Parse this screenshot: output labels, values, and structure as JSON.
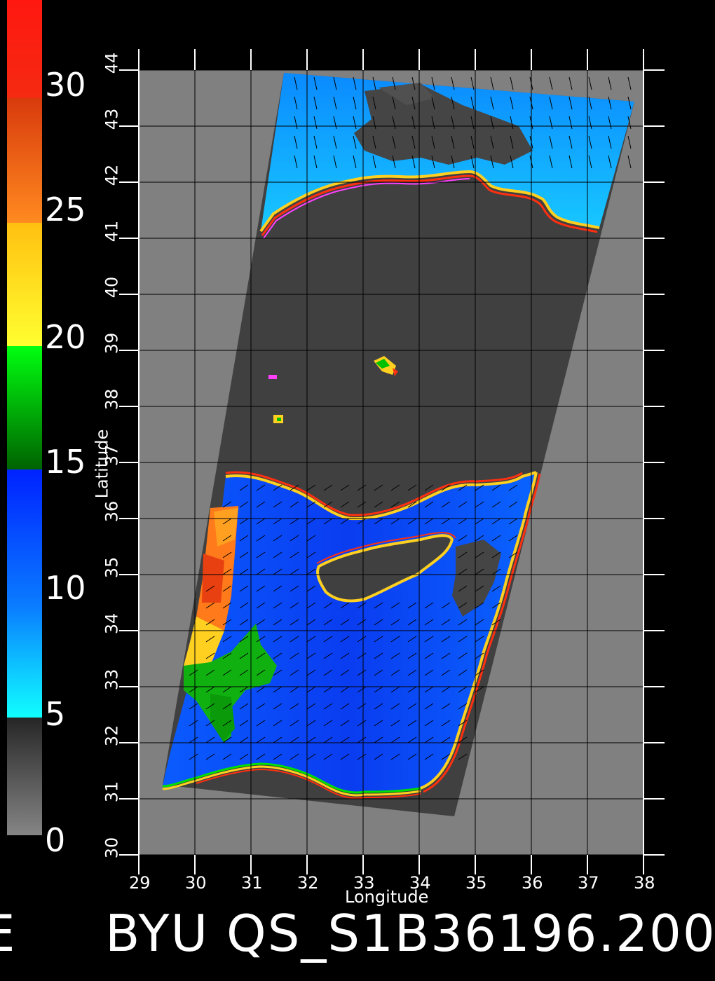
{
  "colorbar": {
    "labels": [
      "30",
      "25",
      "20",
      "15",
      "10",
      "5",
      "0"
    ],
    "colors": {
      "red": "#ff1a10",
      "orange": "#ff7a1a",
      "yellow": "#ffee20",
      "green": "#00d000",
      "darkgreen": "#006b00",
      "blue": "#0a3dff",
      "lightblue": "#10c8ff",
      "cyan": "#10ffff",
      "darkgray": "#303030",
      "gray": "#808080"
    }
  },
  "axes": {
    "xlabel": "Longitude",
    "ylabel": "Latitude",
    "x_ticks": [
      "29",
      "30",
      "31",
      "32",
      "33",
      "34",
      "35",
      "36",
      "37",
      "38"
    ],
    "y_ticks": [
      "30",
      "31",
      "32",
      "33",
      "34",
      "35",
      "36",
      "37",
      "38",
      "39",
      "40",
      "41",
      "42",
      "43",
      "44"
    ]
  },
  "footer": {
    "left_fragment": "E",
    "title": "BYU QS_S1B36196.200"
  }
}
